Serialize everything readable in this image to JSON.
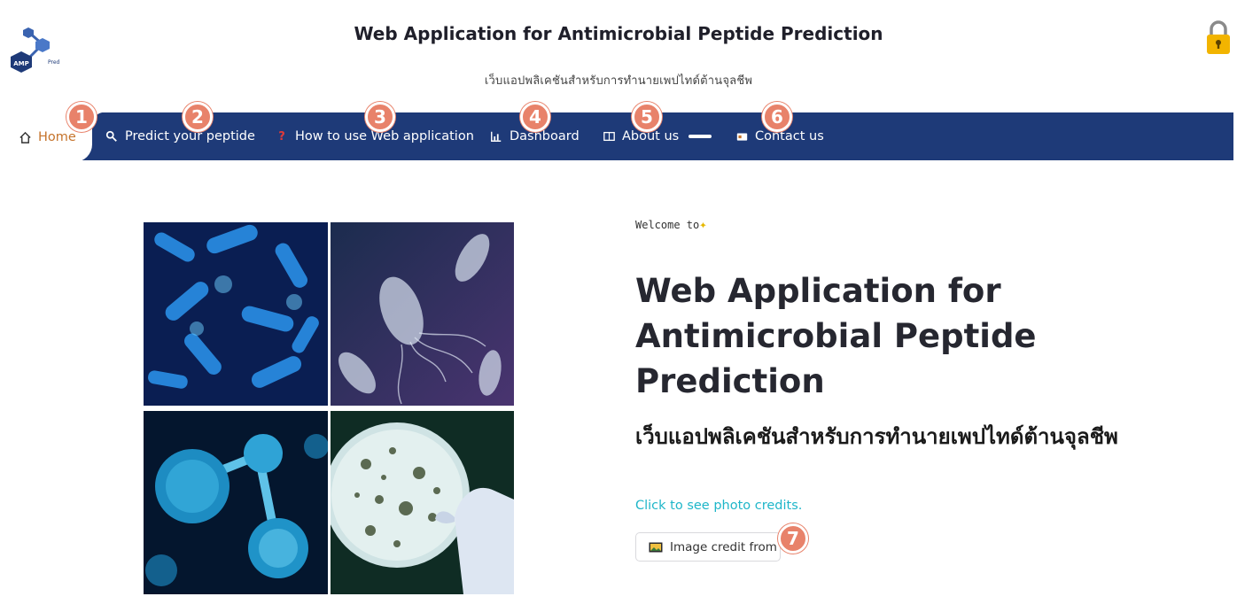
{
  "header": {
    "title": "Web Application for Antimicrobial Peptide Prediction",
    "subtitle": "เว็บแอปพลิเคชันสำหรับการทำนายเพปไทด์ต้านจุลชีพ",
    "logo_icon": "molecule-logo-icon",
    "lock_icon": "padlock-icon"
  },
  "nav": {
    "items": [
      {
        "label": "Home",
        "icon": "house-icon",
        "number": "1"
      },
      {
        "label": "Predict your peptide",
        "icon": "magnifier-icon",
        "number": "2"
      },
      {
        "label": "How to use Web application",
        "icon": "question-mark-icon",
        "number": "3"
      },
      {
        "label": "Dashboard",
        "icon": "chart-icon",
        "number": "4"
      },
      {
        "label": "About us",
        "icon": "book-icon",
        "number": "5"
      },
      {
        "label": "Contact us",
        "icon": "contact-card-icon",
        "number": "6"
      }
    ]
  },
  "content": {
    "welcome": "Welcome to",
    "title": "Web Application for Antimicrobial Peptide Prediction",
    "thai_title": "เว็บแอปพลิเคชันสำหรับการทำนายเพปไทด์ต้านจุลชีพ",
    "credits_link": "Click to see photo credits.",
    "credit_button": "Image credit from",
    "credit_button_number": "7"
  },
  "colors": {
    "nav_bg": "#1e3a78",
    "home_active": "#c5732b",
    "marker": "#e8826a",
    "link": "#1fb6c9"
  }
}
